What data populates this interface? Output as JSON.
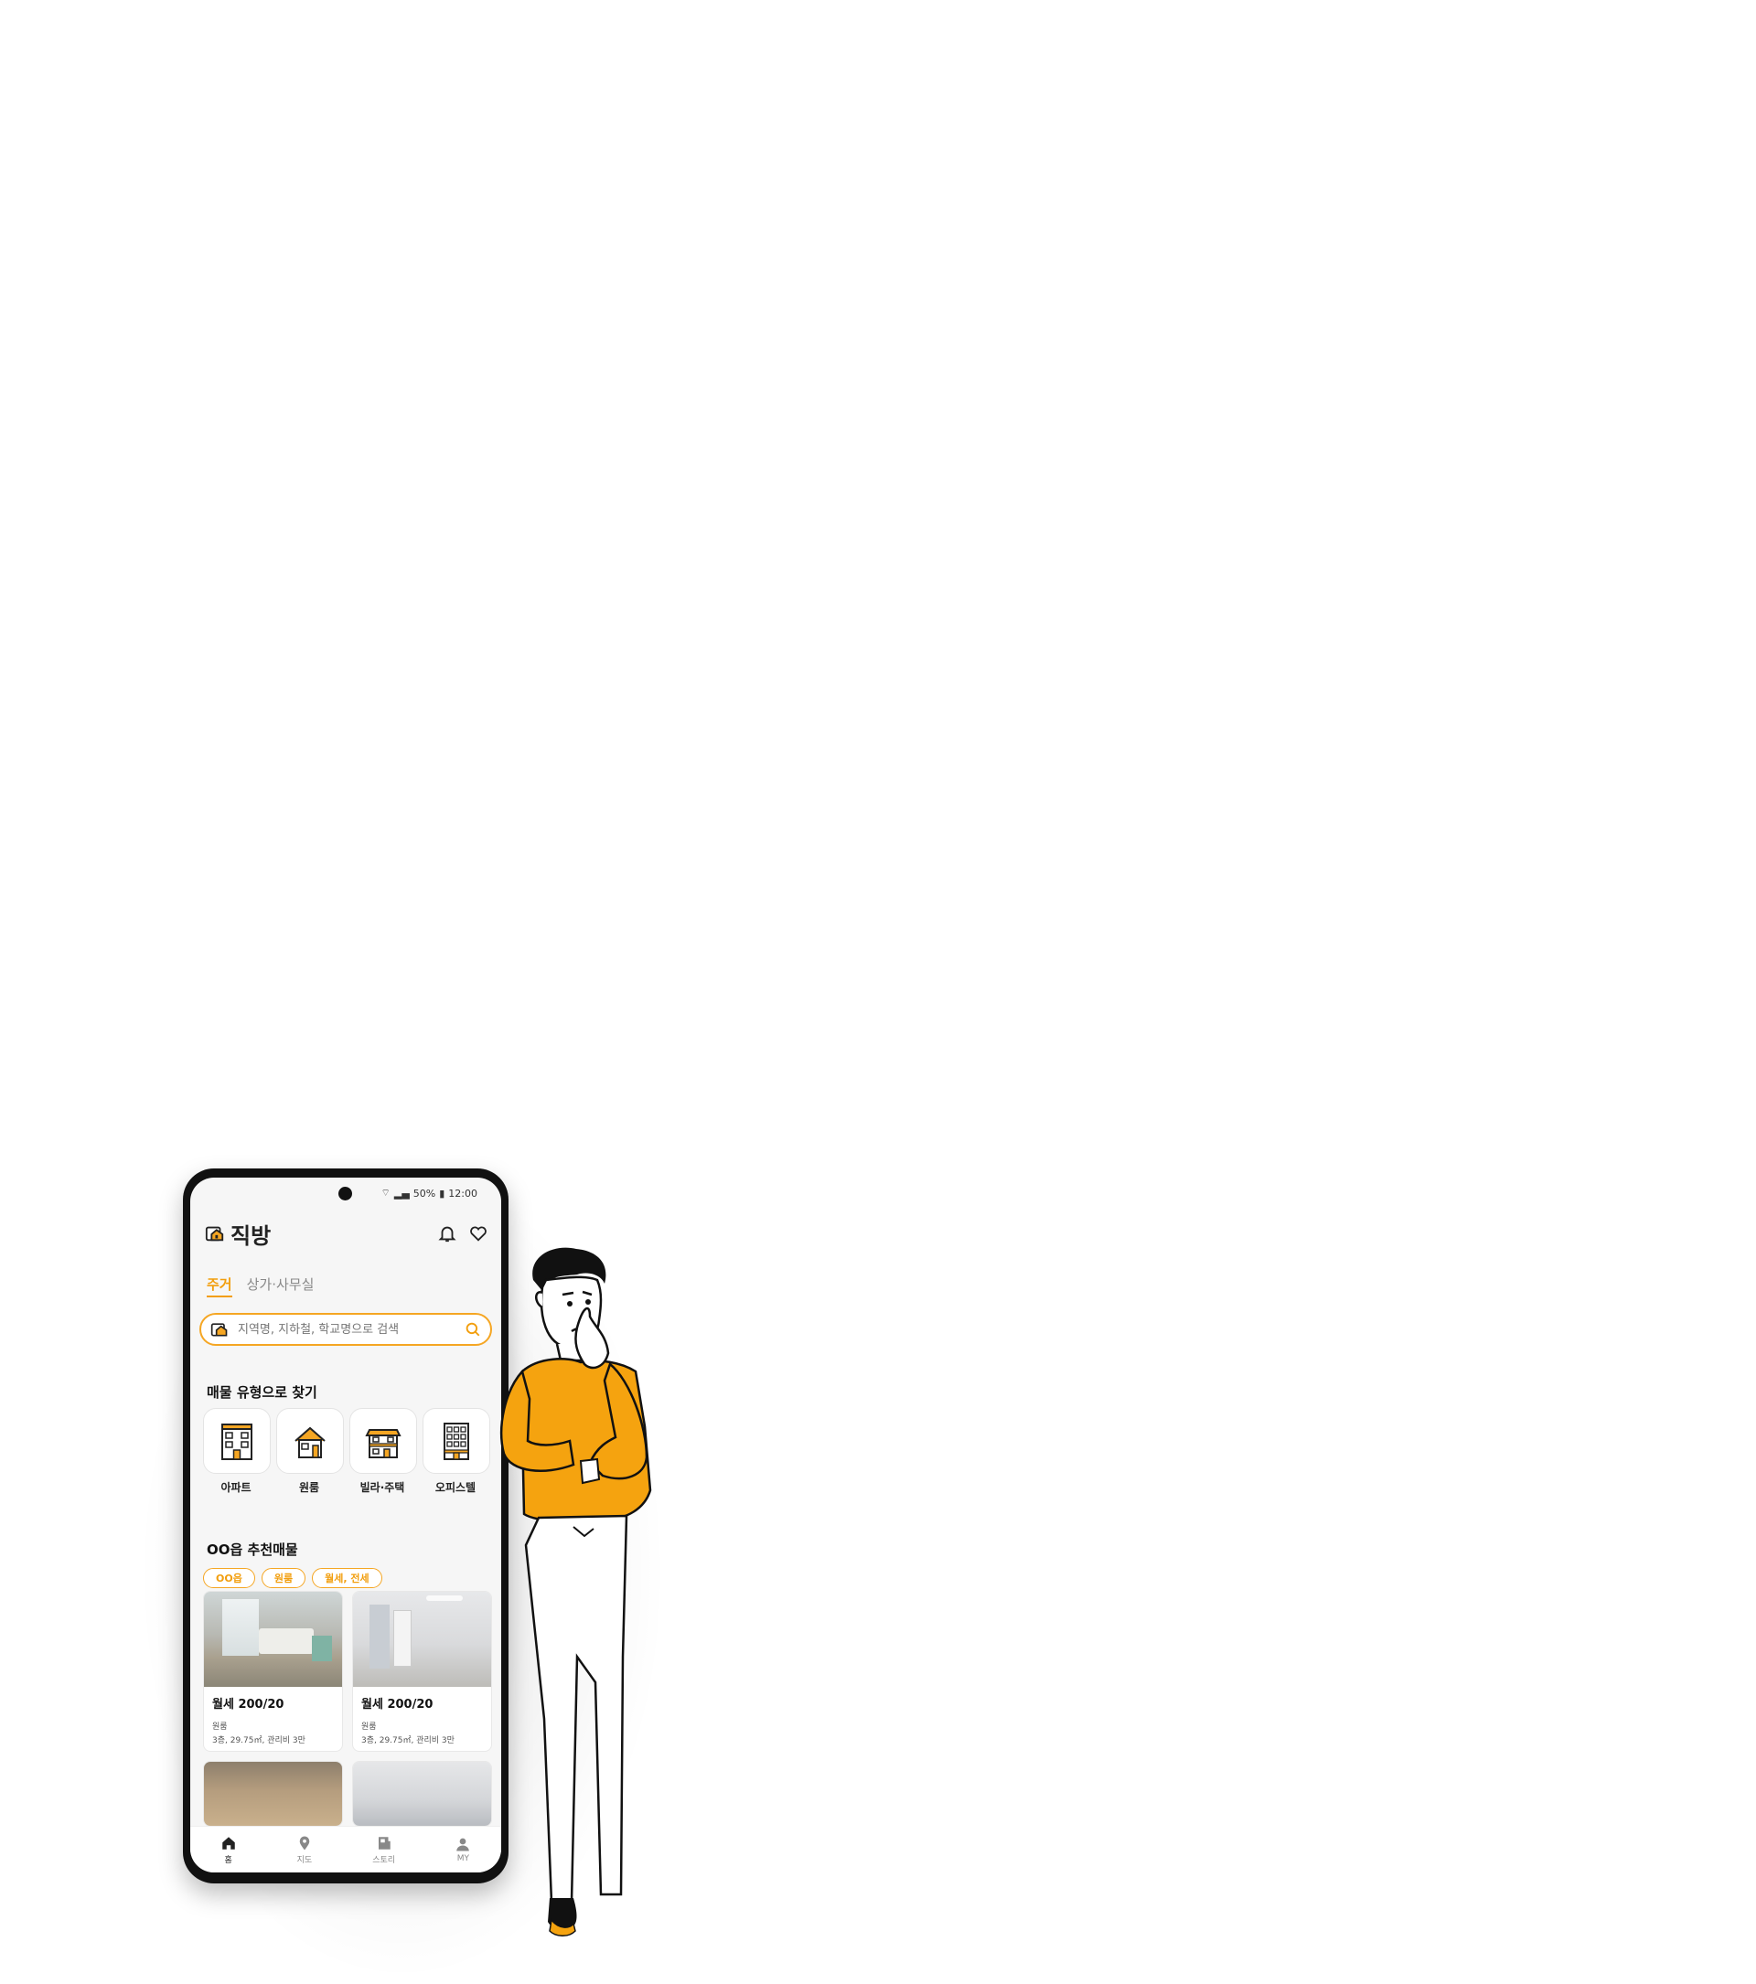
{
  "status_bar": {
    "battery": "50%",
    "time": "12:00"
  },
  "app": {
    "title": "직방"
  },
  "header_icons": [
    "bell-icon",
    "heart-icon"
  ],
  "tabs": [
    {
      "label": "주거"
    },
    {
      "label": "상가·사무실"
    }
  ],
  "search": {
    "placeholder": "지역명, 지하철, 학교명으로 검색"
  },
  "property_types": {
    "title": "매물 유형으로 찾기",
    "items": [
      {
        "label": "아파트",
        "icon": "apartment-icon"
      },
      {
        "label": "원룸",
        "icon": "house-icon"
      },
      {
        "label": "빌라·주택",
        "icon": "villa-icon"
      },
      {
        "label": "오피스텔",
        "icon": "officetel-icon"
      }
    ]
  },
  "recommend": {
    "title": "OO읍 추천매물",
    "chips": [
      "OO읍",
      "원룸",
      "월세, 전세"
    ],
    "cards": [
      {
        "price": "월세 200/20",
        "type": "원룸",
        "detail": "3층, 29.75㎡, 관리비 3만"
      },
      {
        "price": "월세 200/20",
        "type": "원룸",
        "detail": "3층, 29.75㎡, 관리비 3만"
      }
    ]
  },
  "bottom_nav": [
    {
      "label": "홈"
    },
    {
      "label": "지도"
    },
    {
      "label": "스토리"
    },
    {
      "label": "MY"
    }
  ],
  "colors": {
    "accent": "#f5a623",
    "accent_text": "#f29e0d"
  }
}
